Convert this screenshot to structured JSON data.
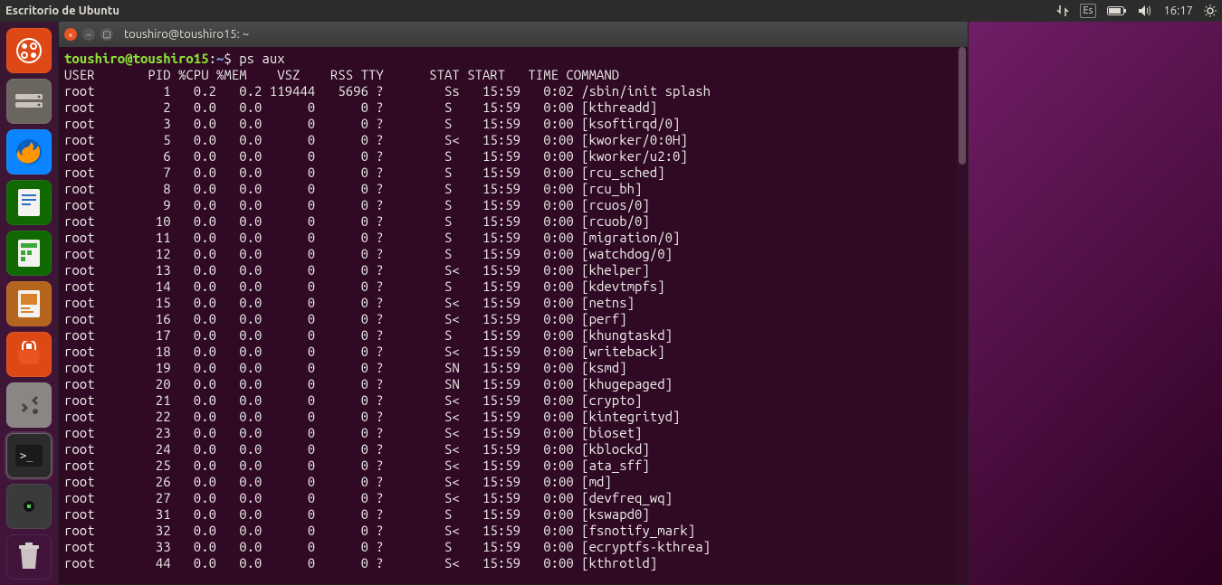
{
  "menubar": {
    "title": "Escritorio de Ubuntu",
    "lang": "Es",
    "time": "16:17"
  },
  "launcher": {
    "items": [
      {
        "name": "dash-icon",
        "color": "#dd4814"
      },
      {
        "name": "files-icon",
        "color": "#6b6560"
      },
      {
        "name": "firefox-icon",
        "color": "#0a84ff"
      },
      {
        "name": "writer-icon",
        "color": "#106802"
      },
      {
        "name": "calc-icon",
        "color": "#106802"
      },
      {
        "name": "impress-icon",
        "color": "#b5651d"
      },
      {
        "name": "software-icon",
        "color": "#dd4814"
      },
      {
        "name": "settings-icon",
        "color": "#8a8683"
      },
      {
        "name": "terminal-icon",
        "color": "#2b2b2b",
        "active": true
      },
      {
        "name": "backup-icon",
        "color": "#3b3b3b"
      },
      {
        "name": "trash-icon",
        "color": "transparent"
      }
    ]
  },
  "terminal": {
    "title": "toushiro@toushiro15: ~",
    "prompt_user": "toushiro@toushiro15",
    "prompt_path": "~",
    "prompt_symbol": "$",
    "command": "ps aux",
    "headers": [
      "USER",
      "PID",
      "%CPU",
      "%MEM",
      "VSZ",
      "RSS",
      "TTY",
      "STAT",
      "START",
      "TIME",
      "COMMAND"
    ],
    "rows": [
      {
        "user": "root",
        "pid": 1,
        "cpu": "0.2",
        "mem": "0.2",
        "vsz": "119444",
        "rss": "5696",
        "tty": "?",
        "stat": "Ss",
        "start": "15:59",
        "time": "0:02",
        "cmd": "/sbin/init splash"
      },
      {
        "user": "root",
        "pid": 2,
        "cpu": "0.0",
        "mem": "0.0",
        "vsz": "0",
        "rss": "0",
        "tty": "?",
        "stat": "S",
        "start": "15:59",
        "time": "0:00",
        "cmd": "[kthreadd]"
      },
      {
        "user": "root",
        "pid": 3,
        "cpu": "0.0",
        "mem": "0.0",
        "vsz": "0",
        "rss": "0",
        "tty": "?",
        "stat": "S",
        "start": "15:59",
        "time": "0:00",
        "cmd": "[ksoftirqd/0]"
      },
      {
        "user": "root",
        "pid": 5,
        "cpu": "0.0",
        "mem": "0.0",
        "vsz": "0",
        "rss": "0",
        "tty": "?",
        "stat": "S<",
        "start": "15:59",
        "time": "0:00",
        "cmd": "[kworker/0:0H]"
      },
      {
        "user": "root",
        "pid": 6,
        "cpu": "0.0",
        "mem": "0.0",
        "vsz": "0",
        "rss": "0",
        "tty": "?",
        "stat": "S",
        "start": "15:59",
        "time": "0:00",
        "cmd": "[kworker/u2:0]"
      },
      {
        "user": "root",
        "pid": 7,
        "cpu": "0.0",
        "mem": "0.0",
        "vsz": "0",
        "rss": "0",
        "tty": "?",
        "stat": "S",
        "start": "15:59",
        "time": "0:00",
        "cmd": "[rcu_sched]"
      },
      {
        "user": "root",
        "pid": 8,
        "cpu": "0.0",
        "mem": "0.0",
        "vsz": "0",
        "rss": "0",
        "tty": "?",
        "stat": "S",
        "start": "15:59",
        "time": "0:00",
        "cmd": "[rcu_bh]"
      },
      {
        "user": "root",
        "pid": 9,
        "cpu": "0.0",
        "mem": "0.0",
        "vsz": "0",
        "rss": "0",
        "tty": "?",
        "stat": "S",
        "start": "15:59",
        "time": "0:00",
        "cmd": "[rcuos/0]"
      },
      {
        "user": "root",
        "pid": 10,
        "cpu": "0.0",
        "mem": "0.0",
        "vsz": "0",
        "rss": "0",
        "tty": "?",
        "stat": "S",
        "start": "15:59",
        "time": "0:00",
        "cmd": "[rcuob/0]"
      },
      {
        "user": "root",
        "pid": 11,
        "cpu": "0.0",
        "mem": "0.0",
        "vsz": "0",
        "rss": "0",
        "tty": "?",
        "stat": "S",
        "start": "15:59",
        "time": "0:00",
        "cmd": "[migration/0]"
      },
      {
        "user": "root",
        "pid": 12,
        "cpu": "0.0",
        "mem": "0.0",
        "vsz": "0",
        "rss": "0",
        "tty": "?",
        "stat": "S",
        "start": "15:59",
        "time": "0:00",
        "cmd": "[watchdog/0]"
      },
      {
        "user": "root",
        "pid": 13,
        "cpu": "0.0",
        "mem": "0.0",
        "vsz": "0",
        "rss": "0",
        "tty": "?",
        "stat": "S<",
        "start": "15:59",
        "time": "0:00",
        "cmd": "[khelper]"
      },
      {
        "user": "root",
        "pid": 14,
        "cpu": "0.0",
        "mem": "0.0",
        "vsz": "0",
        "rss": "0",
        "tty": "?",
        "stat": "S",
        "start": "15:59",
        "time": "0:00",
        "cmd": "[kdevtmpfs]"
      },
      {
        "user": "root",
        "pid": 15,
        "cpu": "0.0",
        "mem": "0.0",
        "vsz": "0",
        "rss": "0",
        "tty": "?",
        "stat": "S<",
        "start": "15:59",
        "time": "0:00",
        "cmd": "[netns]"
      },
      {
        "user": "root",
        "pid": 16,
        "cpu": "0.0",
        "mem": "0.0",
        "vsz": "0",
        "rss": "0",
        "tty": "?",
        "stat": "S<",
        "start": "15:59",
        "time": "0:00",
        "cmd": "[perf]"
      },
      {
        "user": "root",
        "pid": 17,
        "cpu": "0.0",
        "mem": "0.0",
        "vsz": "0",
        "rss": "0",
        "tty": "?",
        "stat": "S",
        "start": "15:59",
        "time": "0:00",
        "cmd": "[khungtaskd]"
      },
      {
        "user": "root",
        "pid": 18,
        "cpu": "0.0",
        "mem": "0.0",
        "vsz": "0",
        "rss": "0",
        "tty": "?",
        "stat": "S<",
        "start": "15:59",
        "time": "0:00",
        "cmd": "[writeback]"
      },
      {
        "user": "root",
        "pid": 19,
        "cpu": "0.0",
        "mem": "0.0",
        "vsz": "0",
        "rss": "0",
        "tty": "?",
        "stat": "SN",
        "start": "15:59",
        "time": "0:00",
        "cmd": "[ksmd]"
      },
      {
        "user": "root",
        "pid": 20,
        "cpu": "0.0",
        "mem": "0.0",
        "vsz": "0",
        "rss": "0",
        "tty": "?",
        "stat": "SN",
        "start": "15:59",
        "time": "0:00",
        "cmd": "[khugepaged]"
      },
      {
        "user": "root",
        "pid": 21,
        "cpu": "0.0",
        "mem": "0.0",
        "vsz": "0",
        "rss": "0",
        "tty": "?",
        "stat": "S<",
        "start": "15:59",
        "time": "0:00",
        "cmd": "[crypto]"
      },
      {
        "user": "root",
        "pid": 22,
        "cpu": "0.0",
        "mem": "0.0",
        "vsz": "0",
        "rss": "0",
        "tty": "?",
        "stat": "S<",
        "start": "15:59",
        "time": "0:00",
        "cmd": "[kintegrityd]"
      },
      {
        "user": "root",
        "pid": 23,
        "cpu": "0.0",
        "mem": "0.0",
        "vsz": "0",
        "rss": "0",
        "tty": "?",
        "stat": "S<",
        "start": "15:59",
        "time": "0:00",
        "cmd": "[bioset]"
      },
      {
        "user": "root",
        "pid": 24,
        "cpu": "0.0",
        "mem": "0.0",
        "vsz": "0",
        "rss": "0",
        "tty": "?",
        "stat": "S<",
        "start": "15:59",
        "time": "0:00",
        "cmd": "[kblockd]"
      },
      {
        "user": "root",
        "pid": 25,
        "cpu": "0.0",
        "mem": "0.0",
        "vsz": "0",
        "rss": "0",
        "tty": "?",
        "stat": "S<",
        "start": "15:59",
        "time": "0:00",
        "cmd": "[ata_sff]"
      },
      {
        "user": "root",
        "pid": 26,
        "cpu": "0.0",
        "mem": "0.0",
        "vsz": "0",
        "rss": "0",
        "tty": "?",
        "stat": "S<",
        "start": "15:59",
        "time": "0:00",
        "cmd": "[md]"
      },
      {
        "user": "root",
        "pid": 27,
        "cpu": "0.0",
        "mem": "0.0",
        "vsz": "0",
        "rss": "0",
        "tty": "?",
        "stat": "S<",
        "start": "15:59",
        "time": "0:00",
        "cmd": "[devfreq_wq]"
      },
      {
        "user": "root",
        "pid": 31,
        "cpu": "0.0",
        "mem": "0.0",
        "vsz": "0",
        "rss": "0",
        "tty": "?",
        "stat": "S",
        "start": "15:59",
        "time": "0:00",
        "cmd": "[kswapd0]"
      },
      {
        "user": "root",
        "pid": 32,
        "cpu": "0.0",
        "mem": "0.0",
        "vsz": "0",
        "rss": "0",
        "tty": "?",
        "stat": "S<",
        "start": "15:59",
        "time": "0:00",
        "cmd": "[fsnotify_mark]"
      },
      {
        "user": "root",
        "pid": 33,
        "cpu": "0.0",
        "mem": "0.0",
        "vsz": "0",
        "rss": "0",
        "tty": "?",
        "stat": "S",
        "start": "15:59",
        "time": "0:00",
        "cmd": "[ecryptfs-kthrea]"
      },
      {
        "user": "root",
        "pid": 44,
        "cpu": "0.0",
        "mem": "0.0",
        "vsz": "0",
        "rss": "0",
        "tty": "?",
        "stat": "S<",
        "start": "15:59",
        "time": "0:00",
        "cmd": "[kthrotld]"
      }
    ]
  }
}
